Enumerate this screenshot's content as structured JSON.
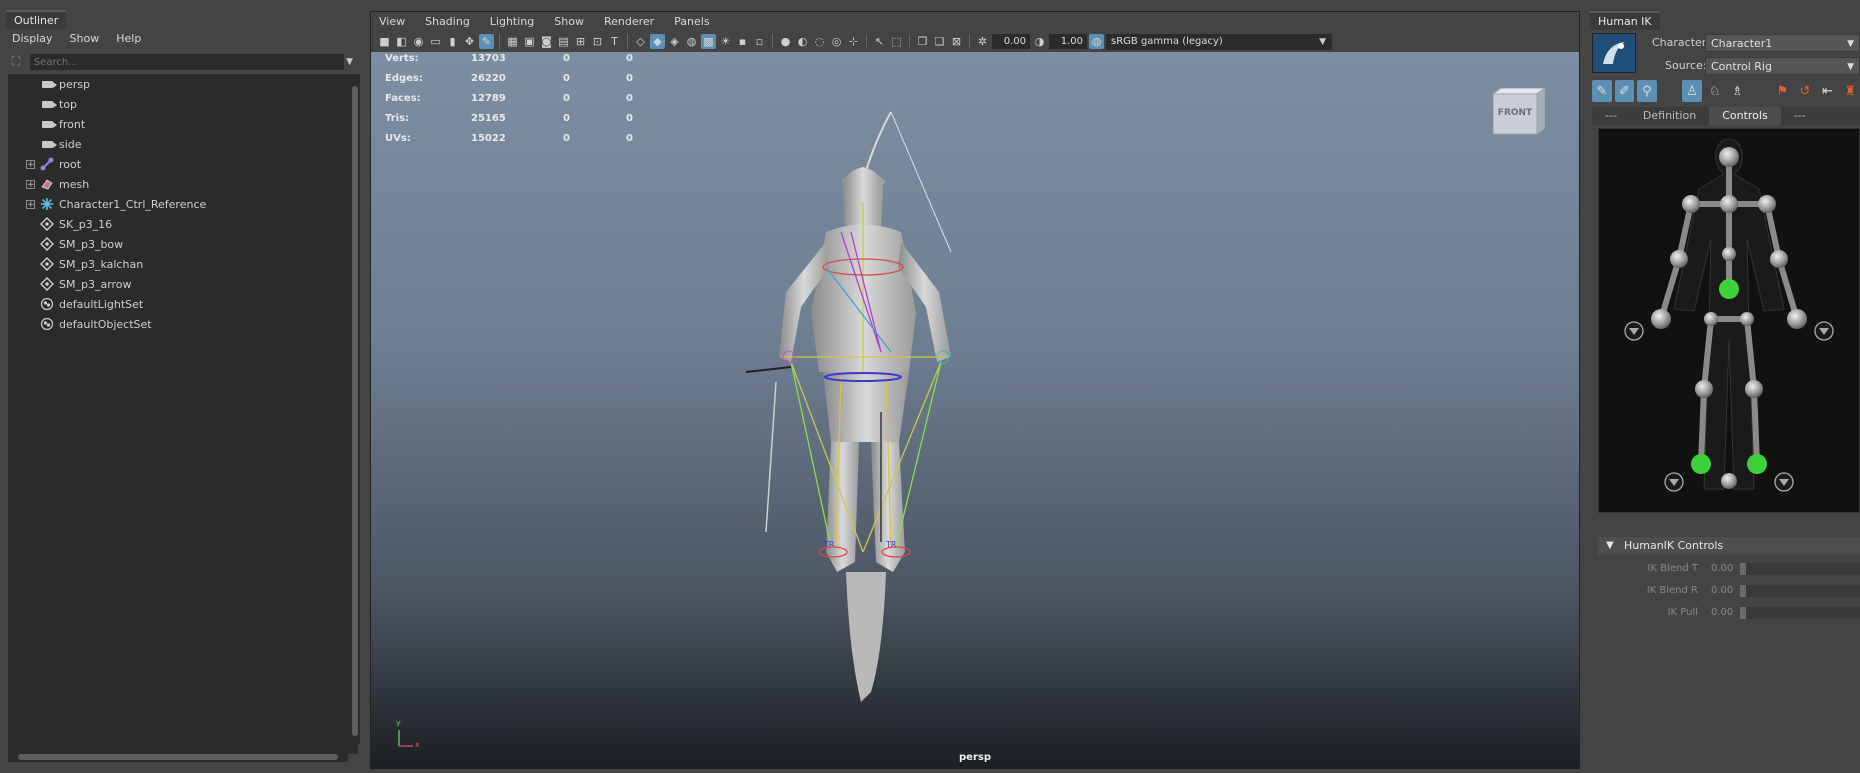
{
  "outliner": {
    "tab": "Outliner",
    "menu": [
      "Display",
      "Show",
      "Help"
    ],
    "search_placeholder": "Search...",
    "items": [
      {
        "label": "persp",
        "icon": "camera-icon",
        "expandable": false
      },
      {
        "label": "top",
        "icon": "camera-icon",
        "expandable": false
      },
      {
        "label": "front",
        "icon": "camera-icon",
        "expandable": false
      },
      {
        "label": "side",
        "icon": "camera-icon",
        "expandable": false
      },
      {
        "label": "root",
        "icon": "joint-icon",
        "expandable": true
      },
      {
        "label": "mesh",
        "icon": "mesh-icon",
        "expandable": true
      },
      {
        "label": "Character1_Ctrl_Reference",
        "icon": "ctrl-reference-icon",
        "expandable": true
      },
      {
        "label": "SK_p3_16",
        "icon": "transform-icon",
        "expandable": false
      },
      {
        "label": "SM_p3_bow",
        "icon": "transform-icon",
        "expandable": false
      },
      {
        "label": "SM_p3_kalchan",
        "icon": "transform-icon",
        "expandable": false
      },
      {
        "label": "SM_p3_arrow",
        "icon": "transform-icon",
        "expandable": false
      },
      {
        "label": "defaultLightSet",
        "icon": "set-icon",
        "expandable": false
      },
      {
        "label": "defaultObjectSet",
        "icon": "set-icon",
        "expandable": false
      }
    ]
  },
  "viewport": {
    "menu": [
      "View",
      "Shading",
      "Lighting",
      "Show",
      "Renderer",
      "Panels"
    ],
    "exposure": "0.00",
    "gamma": "1.00",
    "color_space": "sRGB gamma (legacy)",
    "hud": [
      {
        "key": "Verts:",
        "v1": "13703",
        "v2": "0",
        "v3": "0"
      },
      {
        "key": "Edges:",
        "v1": "26220",
        "v2": "0",
        "v3": "0"
      },
      {
        "key": "Faces:",
        "v1": "12789",
        "v2": "0",
        "v3": "0"
      },
      {
        "key": "Tris:",
        "v1": "25165",
        "v2": "0",
        "v3": "0"
      },
      {
        "key": "UVs:",
        "v1": "15022",
        "v2": "0",
        "v3": "0"
      }
    ],
    "view_cube": "FRONT",
    "camera_label": "persp",
    "axis_y": "y",
    "axis_x": "x"
  },
  "human_ik": {
    "tab": "Human IK",
    "character_label": "Character:",
    "character_value": "Character1",
    "source_label": "Source:",
    "source_value": "Control Rig",
    "subtabs": [
      "---",
      "Definition",
      "Controls",
      "---"
    ],
    "active_subtab": "Controls",
    "section_title": "HumanIK Controls",
    "controls": [
      {
        "label": "IK Blend T",
        "value": "0.00"
      },
      {
        "label": "IK Blend R",
        "value": "0.00"
      },
      {
        "label": "IK Pull",
        "value": "0.00"
      }
    ],
    "colors": {
      "active_tool": "#5b8fb4",
      "effector_active": "#3fd13a"
    }
  }
}
